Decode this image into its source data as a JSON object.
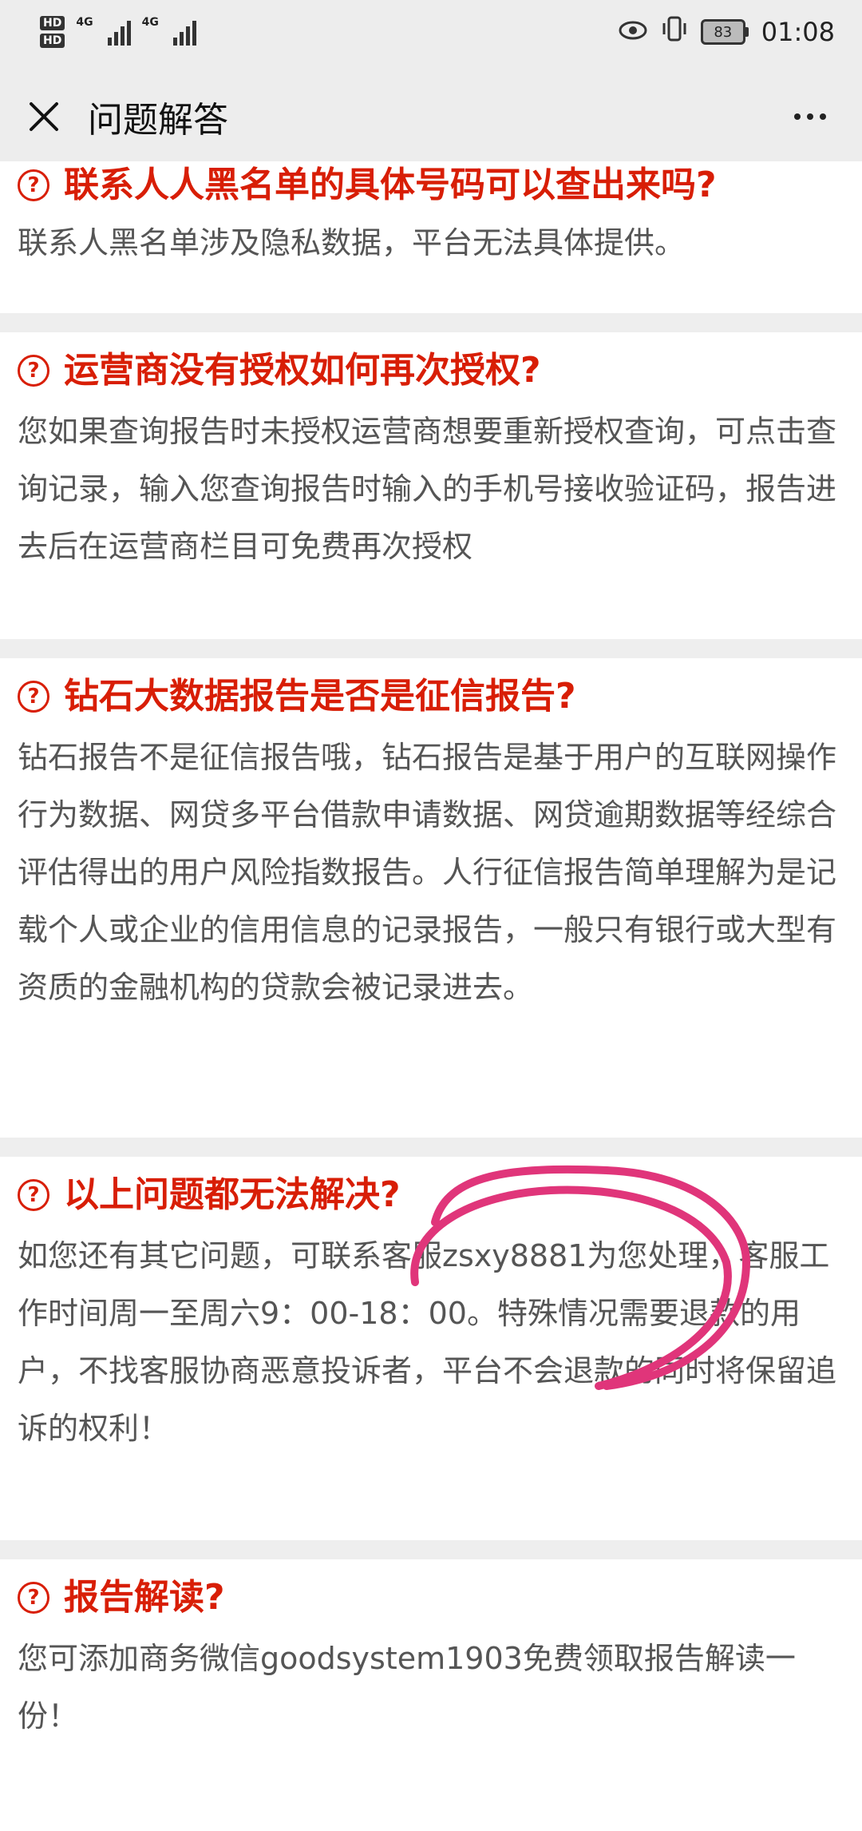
{
  "status_bar": {
    "hd1": "HD",
    "hd2": "HD",
    "net1": "4G",
    "net2": "4G",
    "battery": "83",
    "time": "01:08"
  },
  "header": {
    "title": "问题解答"
  },
  "faq": [
    {
      "question": "联系人人黑名单的具体号码可以查出来吗?",
      "answer": "联系人黑名单涉及隐私数据，平台无法具体提供。"
    },
    {
      "question": "运营商没有授权如何再次授权?",
      "answer": "您如果查询报告时未授权运营商想要重新授权查询，可点击查询记录，输入您查询报告时输入的手机号接收验证码，报告进去后在运营商栏目可免费再次授权"
    },
    {
      "question": "钻石大数据报告是否是征信报告?",
      "answer": "钻石报告不是征信报告哦，钻石报告是基于用户的互联网操作行为数据、网贷多平台借款申请数据、网贷逾期数据等经综合评估得出的用户风险指数报告。人行征信报告简单理解为是记载个人或企业的信用信息的记录报告，一般只有银行或大型有资质的金融机构的贷款会被记录进去。"
    },
    {
      "question": "以上问题都无法解决?",
      "answer": "如您还有其它问题，可联系客服zsxy8881为您处理，客服工作时间周一至周六9：00-18：00。特殊情况需要退款的用户，不找客服协商恶意投诉者，平台不会退款的同时将保留追诉的权利！"
    },
    {
      "question": "报告解读?",
      "answer": "您可添加商务微信goodsystem1903免费领取报告解读一份！"
    }
  ],
  "colors": {
    "question": "#d81e06",
    "annotation": "#e0357a"
  },
  "icons": {
    "close": "close-icon",
    "more": "more-icon",
    "question": "question-circle-icon"
  }
}
